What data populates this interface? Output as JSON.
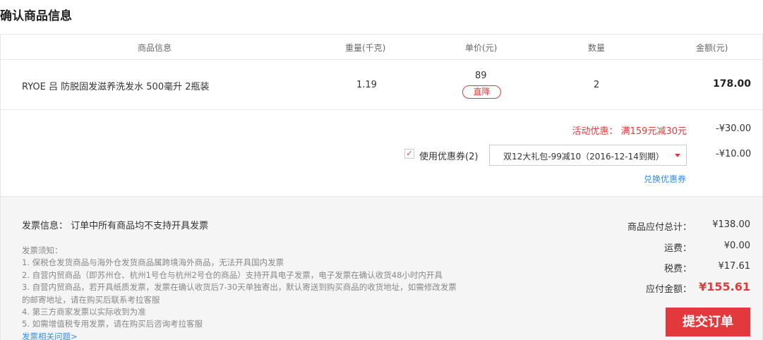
{
  "title": "确认商品信息",
  "table": {
    "headers": [
      "商品信息",
      "重量(千克)",
      "单价(元)",
      "数量",
      "金额(元)"
    ],
    "item": {
      "name": "RYOE 吕 防脱固发滋养洗发水 500毫升 2瓶装",
      "weight": "1.19",
      "price": "89",
      "tag": "直降",
      "qty": "2",
      "amount": "178.00"
    }
  },
  "promo": {
    "activity_label": "活动优惠： 满159元减30元",
    "activity_value": "-¥30.00",
    "checkbox_mark": "✓",
    "coupon_label": "使用优惠券(2)",
    "coupon_selected": "双12大礼包-99减10（2016-12-14到期）",
    "coupon_value": "-¥10.00",
    "swap_link": "兑换优惠券"
  },
  "invoice": {
    "title": "发票信息： 订单中所有商品均不支持开具发票",
    "notes": [
      "发票须知：",
      "1. 保税仓发货商品与海外仓发货商品属跨境海外商品，无法开具国内发票",
      "2. 自营内贸商品（即苏州仓、杭州1号仓与杭州2号仓的商品）支持开具电子发票，电子发票在确认收货48小时内开具",
      "3. 自营内贸商品，若开具纸质发票，发票在确认收货后7-30天单独寄出，默认寄送到购买商品的收货地址，如需修改发票",
      "的邮寄地址，请在购买后联系考拉客服",
      "4. 第三方商家发票以实际收到为准",
      "5. 如需增值税专用发票，请在购买后咨询考拉客服"
    ],
    "help_link": "发票相关问题>"
  },
  "summary": {
    "subtotal_label": "商品应付总计：",
    "subtotal_value": "¥138.00",
    "shipping_label": "运费：",
    "shipping_value": "¥0.00",
    "tax_label": "税费：",
    "tax_value": "¥17.61",
    "due_label": "应付金额：",
    "due_value": "¥155.61"
  },
  "submit_label": "提交订单",
  "colors": {
    "accent": "#e4393c",
    "link": "#3b8be6"
  }
}
